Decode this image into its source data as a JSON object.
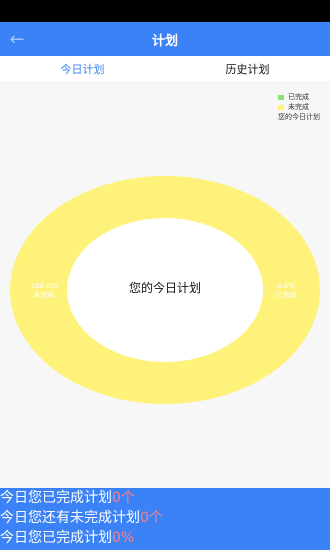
{
  "app": {
    "title": "计划",
    "back_icon": "arrow-left-icon"
  },
  "tabs": [
    {
      "label": "今日计划",
      "active": true
    },
    {
      "label": "历史计划",
      "active": false
    }
  ],
  "colors": {
    "accent": "#3b82f6",
    "completed": "#8fe07a",
    "incomplete": "#fff27a",
    "highlight": "#ff7f7f"
  },
  "chart": {
    "center_text": "您的今日计划",
    "left_label_line1": "100.0%",
    "left_label_line2": "未完成",
    "right_label_line1": "0.0%",
    "right_label_line2": "已完成"
  },
  "legend": [
    {
      "label": "已完成"
    },
    {
      "label": "未完成"
    },
    {
      "label": "您的今日计划"
    }
  ],
  "chart_data": {
    "type": "pie",
    "title": "您的今日计划",
    "categories": [
      "已完成",
      "未完成"
    ],
    "values": [
      0,
      100
    ],
    "unit": "%",
    "donut": true
  },
  "summary": {
    "line1_prefix": "今日您已完成计划",
    "line1_value": "0个",
    "line2_prefix": "今日您还有未完成计划",
    "line2_value": "0个",
    "line3_prefix": "今日您已完成计划",
    "line3_value": "0%"
  }
}
